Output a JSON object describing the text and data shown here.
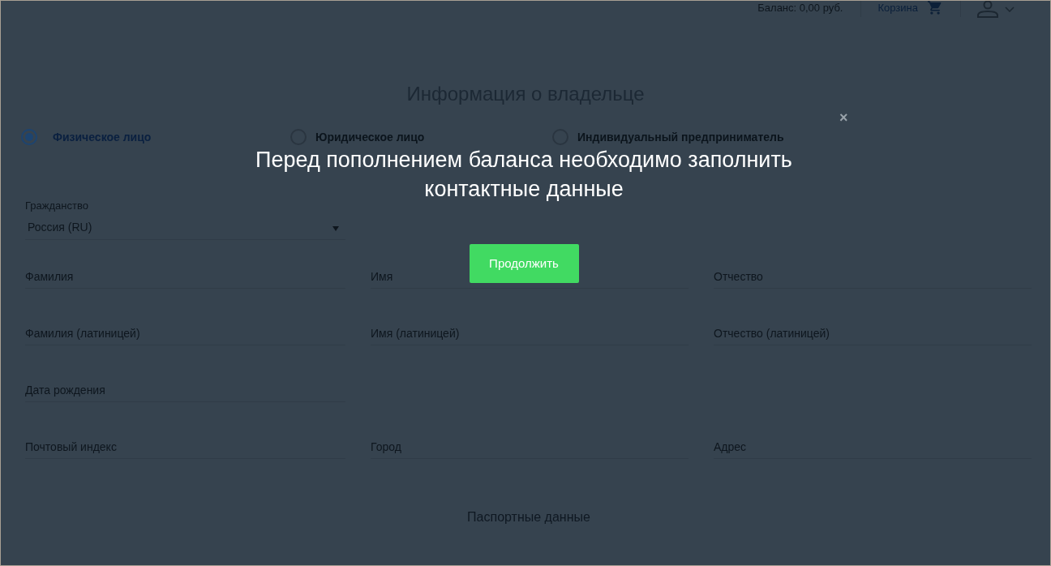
{
  "header": {
    "balance": "Баланс: 0,00 руб.",
    "cart_link": "Корзина"
  },
  "page": {
    "title": "Информация о владельце",
    "owner_types": [
      {
        "label": "Физическое лицо",
        "selected": true
      },
      {
        "label": "Юридическое лицо",
        "selected": false
      },
      {
        "label": "Индивидуальный предприниматель",
        "selected": false
      }
    ],
    "citizenship": {
      "label": "Гражданство",
      "value": "Россия (RU)"
    },
    "field_rows": [
      [
        {
          "placeholder": "Фамилия"
        },
        {
          "placeholder": "Имя"
        },
        {
          "placeholder": "Отчество"
        }
      ],
      [
        {
          "placeholder": "Фамилия (латиницей)"
        },
        {
          "placeholder": "Имя (латиницей)"
        },
        {
          "placeholder": "Отчество (латиницей)"
        }
      ],
      [
        {
          "placeholder": "Дата рождения"
        }
      ],
      [
        {
          "placeholder": "Почтовый индекс"
        },
        {
          "placeholder": "Город"
        },
        {
          "placeholder": "Адрес"
        }
      ]
    ],
    "section_title": "Паспортные данные"
  },
  "dialog": {
    "close": "×",
    "message": "Перед пополнением баланса необходимо заполнить контактные данные",
    "button": "Продолжить"
  }
}
